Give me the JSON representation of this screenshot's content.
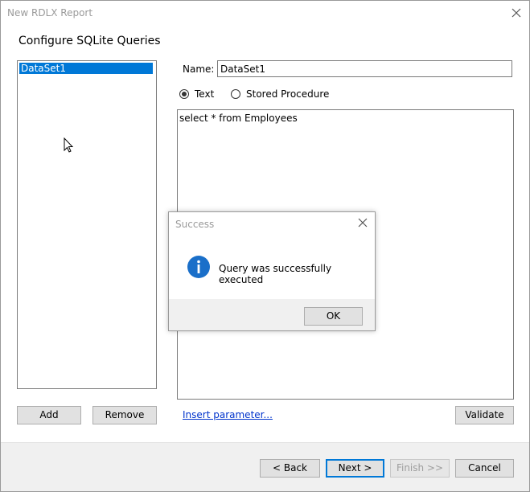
{
  "window": {
    "title": "New RDLX Report",
    "heading": "Configure SQLite Queries"
  },
  "datasets": {
    "items": [
      "DataSet1"
    ]
  },
  "name_field": {
    "label": "Name:",
    "value": "DataSet1"
  },
  "query_type": {
    "text_label": "Text",
    "stored_procedure_label": "Stored Procedure",
    "selected": "Text"
  },
  "query": {
    "value": "select * from Employees"
  },
  "buttons": {
    "add": "Add",
    "remove": "Remove",
    "insert_parameter": "Insert parameter...",
    "validate": "Validate",
    "back": "< Back",
    "next": "Next >",
    "finish": "Finish >>",
    "cancel": "Cancel"
  },
  "dialog": {
    "title": "Success",
    "message": "Query was successfully executed",
    "ok": "OK"
  },
  "colors": {
    "accent": "#0078d7",
    "info_icon": "#1a6fc9",
    "link": "#0033cc",
    "footer_bg": "#f0f0f0"
  }
}
